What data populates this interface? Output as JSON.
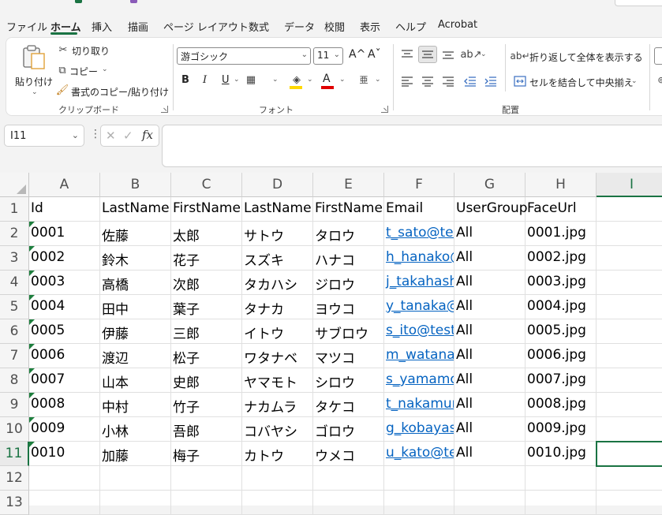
{
  "ribbon_tabs": [
    "ファイル",
    "ホーム",
    "挿入",
    "描画",
    "ページ レイアウト",
    "数式",
    "データ",
    "校閲",
    "表示",
    "ヘルプ",
    "Acrobat"
  ],
  "active_tab": "ホーム",
  "clipboard": {
    "paste": "貼り付け",
    "cut": "切り取り",
    "copy": "コピー",
    "format_painter": "書式のコピー/貼り付け",
    "label": "クリップボード"
  },
  "font": {
    "name": "游ゴシック",
    "size": "11",
    "label": "フォント",
    "grow_glyph": "A^",
    "shrink_glyph": "Aˇ",
    "bold": "B",
    "italic": "I",
    "underline": "U",
    "font_color_glyph": "A"
  },
  "alignment": {
    "wrap_text": "折り返して全体を表示する",
    "merge_center": "セルを結合して中央揃え",
    "label": "配置"
  },
  "accent_colors": {
    "green": "#1a7343",
    "link": "#0563c1",
    "highlight": "#ffd800",
    "font_red": "#e00000"
  },
  "formula_bar": {
    "name_box": "I11",
    "value": ""
  },
  "columns": [
    "A",
    "B",
    "C",
    "D",
    "E",
    "F",
    "G",
    "H",
    "I"
  ],
  "selected_column": "I",
  "selected_row": "11",
  "rows": [
    {
      "n": "1",
      "cells": [
        "Id",
        "LastName",
        "FirstName",
        "LastName",
        "FirstName",
        "Email",
        "UserGroup",
        "FaceUrl",
        ""
      ]
    },
    {
      "n": "2",
      "cells": [
        "0001",
        "佐藤",
        "太郎",
        "サトウ",
        "タロウ",
        "t_sato@test",
        "All",
        "0001.jpg",
        ""
      ]
    },
    {
      "n": "3",
      "cells": [
        "0002",
        "鈴木",
        "花子",
        "スズキ",
        "ハナコ",
        "h_hanako@test",
        "All",
        "0002.jpg",
        ""
      ]
    },
    {
      "n": "4",
      "cells": [
        "0003",
        "高橋",
        "次郎",
        "タカハシ",
        "ジロウ",
        "j_takahashi@test",
        "All",
        "0003.jpg",
        ""
      ]
    },
    {
      "n": "5",
      "cells": [
        "0004",
        "田中",
        "葉子",
        "タナカ",
        "ヨウコ",
        "y_tanaka@test",
        "All",
        "0004.jpg",
        ""
      ]
    },
    {
      "n": "6",
      "cells": [
        "0005",
        "伊藤",
        "三郎",
        "イトウ",
        "サブロウ",
        "s_ito@test",
        "All",
        "0005.jpg",
        ""
      ]
    },
    {
      "n": "7",
      "cells": [
        "0006",
        "渡辺",
        "松子",
        "ワタナベ",
        "マツコ",
        "m_watanabe@test",
        "All",
        "0006.jpg",
        ""
      ]
    },
    {
      "n": "8",
      "cells": [
        "0007",
        "山本",
        "史郎",
        "ヤマモト",
        "シロウ",
        "s_yamamoto@test",
        "All",
        "0007.jpg",
        ""
      ]
    },
    {
      "n": "9",
      "cells": [
        "0008",
        "中村",
        "竹子",
        "ナカムラ",
        "タケコ",
        "t_nakamura@test",
        "All",
        "0008.jpg",
        ""
      ]
    },
    {
      "n": "10",
      "cells": [
        "0009",
        "小林",
        "吾郎",
        "コバヤシ",
        "ゴロウ",
        "g_kobayashi@test",
        "All",
        "0009.jpg",
        ""
      ]
    },
    {
      "n": "11",
      "cells": [
        "0010",
        "加藤",
        "梅子",
        "カトウ",
        "ウメコ",
        "u_kato@test",
        "All",
        "0010.jpg",
        ""
      ]
    },
    {
      "n": "12",
      "cells": [
        "",
        "",
        "",
        "",
        "",
        "",
        "",
        "",
        ""
      ]
    },
    {
      "n": "13",
      "cells": [
        "",
        "",
        "",
        "",
        "",
        "",
        "",
        "",
        ""
      ]
    }
  ]
}
